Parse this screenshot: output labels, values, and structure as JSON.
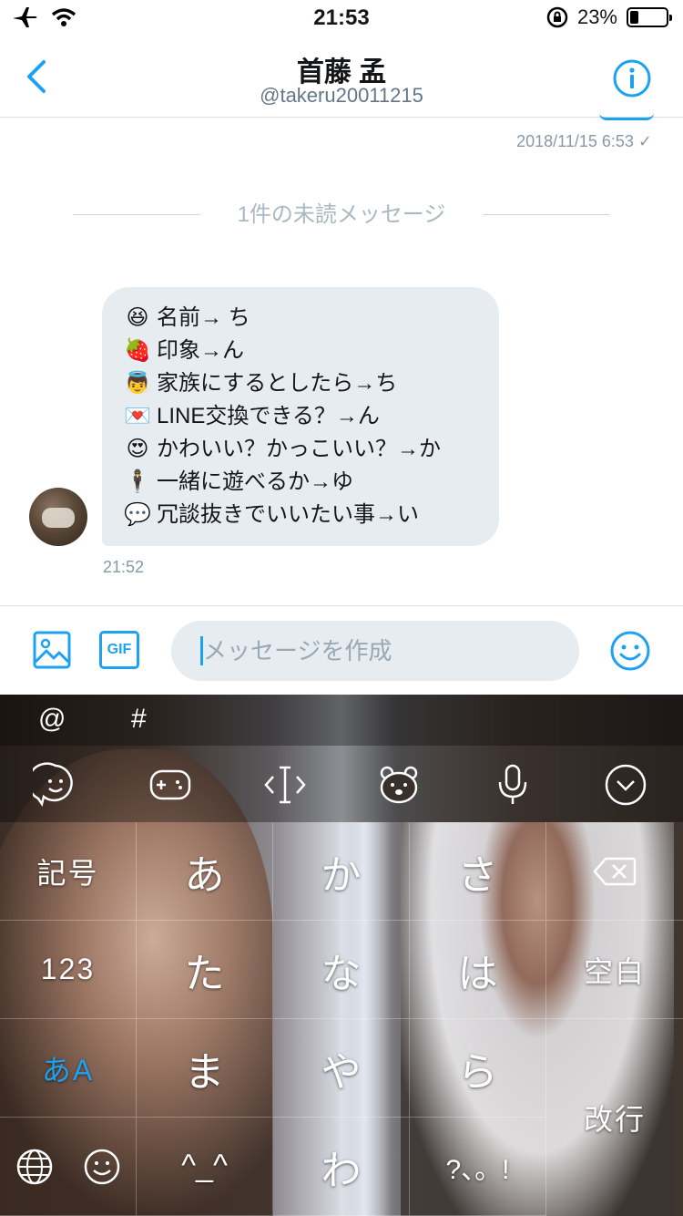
{
  "status_bar": {
    "time": "21:53",
    "battery_percent": "23%",
    "battery_level": 0.23
  },
  "nav": {
    "title": "首藤 孟",
    "handle": "@takeru20011215"
  },
  "conversation": {
    "previous_sent_timestamp": "2018/11/15 6:53",
    "unread_divider": "1件の未読メッセージ",
    "received_message": {
      "lines": [
        {
          "emoji": "😆",
          "text": "名前→ ち"
        },
        {
          "emoji": "🍓",
          "text": "印象→ん"
        },
        {
          "emoji": "👼",
          "text": "家族にするとしたら→ち"
        },
        {
          "emoji": "💌",
          "text": "LINE交換できる？→ん"
        },
        {
          "emoji": "😍",
          "text": "かわいい？かっこいい？→か"
        },
        {
          "emoji": "🕴",
          "text": "一緒に遊べるか→ゆ"
        },
        {
          "emoji": "💬",
          "text": "冗談抜きでいいたい事→い"
        }
      ],
      "timestamp": "21:52"
    }
  },
  "composer": {
    "placeholder": "メッセージを作成",
    "gif_label": "GIF"
  },
  "keyboard": {
    "top_symbols": [
      "@",
      "#"
    ],
    "left_keys": [
      "記号",
      "123",
      "あA"
    ],
    "main_keys": [
      [
        "あ",
        "か",
        "さ"
      ],
      [
        "た",
        "な",
        "は"
      ],
      [
        "ま",
        "や",
        "ら"
      ],
      [
        "^_^",
        "わ",
        "?、。!"
      ]
    ],
    "right_keys": {
      "space": "空白",
      "enter": "改行"
    }
  },
  "colors": {
    "accent": "#1da1f2",
    "bubble": "#e6ecf0",
    "muted": "#8899a6"
  }
}
